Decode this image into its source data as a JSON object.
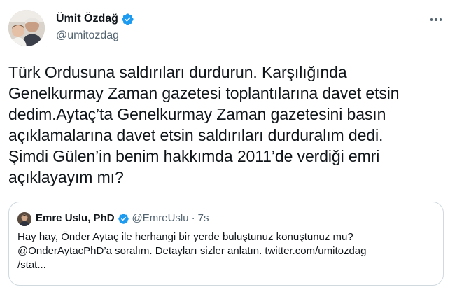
{
  "author": {
    "name": "Ümit Özdağ",
    "handle": "@umitozdag",
    "verified": true,
    "avatar_icon": "profile-photo-icon"
  },
  "more_icon": "more-options-icon",
  "tweet": {
    "text": "Türk Ordusuna saldırıları durdurun. Karşılığında\nGenelkurmay Zaman gazetesi toplantılarına davet etsin\ndedim.Aytaç’ta Genelkurmay Zaman gazetesini basın\naçıklamalarına davet etsin saldırıları durduralım dedi.\nŞimdi Gülen’in benim hakkımda 2011’de verdiği emri\naçıklayayım mı?"
  },
  "quoted_tweet": {
    "name": "Emre Uslu, PhD",
    "verified": true,
    "handle": "@EmreUslu",
    "separator": "·",
    "time": "7s",
    "text": "Hay hay, Önder Aytaç ile herhangi bir yerde buluştunuz konuştunuz mu?\n@OnderAytacPhD’a soralım. Detayları sizler anlatın. twitter.com/umitozdag\n/stat..."
  },
  "colors": {
    "verified_blue": "#1d9bf0",
    "secondary_text": "#536471",
    "primary_text": "#0f1419",
    "border": "#cfd9de"
  }
}
